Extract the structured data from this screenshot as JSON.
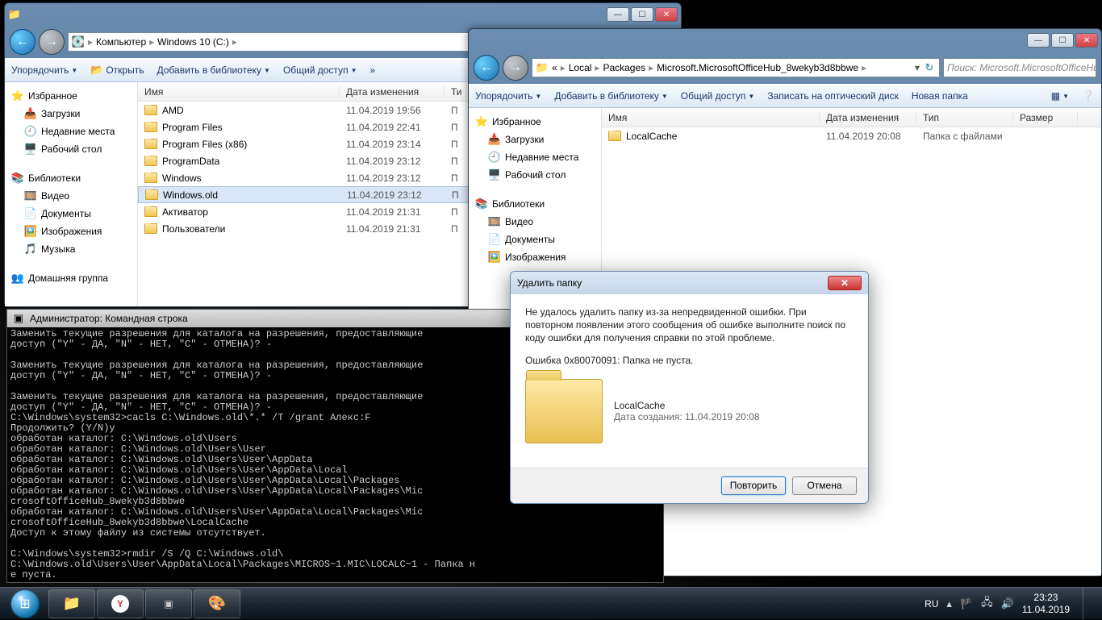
{
  "win1": {
    "breadcrumb": [
      "Компьютер",
      "Windows 10 (C:)"
    ],
    "toolbar": {
      "organize": "Упорядочить",
      "open": "Открыть",
      "addlib": "Добавить в библиотеку",
      "share": "Общий доступ"
    },
    "cols": {
      "name": "Имя",
      "date": "Дата изменения",
      "type": "Ти"
    },
    "sidebar": {
      "fav": "Избранное",
      "downloads": "Загрузки",
      "recent": "Недавние места",
      "desktop": "Рабочий стол",
      "libs": "Библиотеки",
      "video": "Видео",
      "docs": "Документы",
      "pics": "Изображения",
      "music": "Музыка",
      "homegroup": "Домашняя группа"
    },
    "files": [
      {
        "name": "AMD",
        "date": "11.04.2019 19:56",
        "type": "П"
      },
      {
        "name": "Program Files",
        "date": "11.04.2019 22:41",
        "type": "П"
      },
      {
        "name": "Program Files (x86)",
        "date": "11.04.2019 23:14",
        "type": "П"
      },
      {
        "name": "ProgramData",
        "date": "11.04.2019 23:12",
        "type": "П"
      },
      {
        "name": "Windows",
        "date": "11.04.2019 23:12",
        "type": "П"
      },
      {
        "name": "Windows.old",
        "date": "11.04.2019 23:12",
        "type": "П",
        "sel": true
      },
      {
        "name": "Активатор",
        "date": "11.04.2019 21:31",
        "type": "П"
      },
      {
        "name": "Пользователи",
        "date": "11.04.2019 21:31",
        "type": "П"
      }
    ]
  },
  "win2": {
    "breadcrumb_prefix": "«",
    "breadcrumb": [
      "Local",
      "Packages",
      "Microsoft.MicrosoftOfficeHub_8wekyb3d8bbwe"
    ],
    "search_placeholder": "Поиск: Microsoft.MicrosoftOfficeHu",
    "toolbar": {
      "organize": "Упорядочить",
      "addlib": "Добавить в библиотеку",
      "share": "Общий доступ",
      "burn": "Записать на оптический диск",
      "newfolder": "Новая папка"
    },
    "cols": {
      "name": "Имя",
      "date": "Дата изменения",
      "type": "Тип",
      "size": "Размер"
    },
    "sidebar": {
      "fav": "Избранное",
      "downloads": "Загрузки",
      "recent": "Недавние места",
      "desktop": "Рабочий стол",
      "libs": "Библиотеки",
      "video": "Видео",
      "docs": "Документы",
      "pics": "Изображения"
    },
    "files": [
      {
        "name": "LocalCache",
        "date": "11.04.2019 20:08",
        "type": "Папка с файлами"
      }
    ]
  },
  "cmd": {
    "title": "Администратор: Командная строка",
    "text": "Заменить текущие разрешения для каталога на разрешения, предоставляющие\nдоступ (\"Y\" - ДА, \"N\" - НЕТ, \"C\" - ОТМЕНА)? -\n\nЗаменить текущие разрешения для каталога на разрешения, предоставляющие\nдоступ (\"Y\" - ДА, \"N\" - НЕТ, \"C\" - ОТМЕНА)? -\n\nЗаменить текущие разрешения для каталога на разрешения, предоставляющие\nдоступ (\"Y\" - ДА, \"N\" - НЕТ, \"C\" - ОТМЕНА)? -\nC:\\Windows\\system32>cacls C:\\Windows.old\\*.* /T /grant Алекс:F\nПродолжить? (Y/N)y\nобработан каталог: C:\\Windows.old\\Users\nобработан каталог: C:\\Windows.old\\Users\\User\nобработан каталог: C:\\Windows.old\\Users\\User\\AppData\nобработан каталог: C:\\Windows.old\\Users\\User\\AppData\\Local\nобработан каталог: C:\\Windows.old\\Users\\User\\AppData\\Local\\Packages\nобработан каталог: C:\\Windows.old\\Users\\User\\AppData\\Local\\Packages\\Mic\ncrosoftOfficeHub_8wekyb3d8bbwe\nобработан каталог: C:\\Windows.old\\Users\\User\\AppData\\Local\\Packages\\Mic\ncrosoftOfficeHub_8wekyb3d8bbwe\\LocalCache\nДоступ к этому файлу из системы отсутствует.\n\nC:\\Windows\\system32>rmdir /S /Q C:\\Windows.old\\\nC:\\Windows.old\\Users\\User\\AppData\\Local\\Packages\\MICROS~1.MIC\\LOCALC~1 - Папка н\nе пуста.\n"
  },
  "dialog": {
    "title": "Удалить папку",
    "msg": "Не удалось удалить папку из-за непредвиденной ошибки. При повторном появлении этого сообщения об ошибке выполните поиск по коду ошибки для получения справки по этой проблеме.",
    "err": "Ошибка 0x80070091: Папка не пуста.",
    "folder_name": "LocalCache",
    "folder_date": "Дата создания: 11.04.2019 20:08",
    "retry": "Повторить",
    "cancel": "Отмена"
  },
  "taskbar": {
    "lang": "RU",
    "time": "23:23",
    "date": "11.04.2019"
  }
}
